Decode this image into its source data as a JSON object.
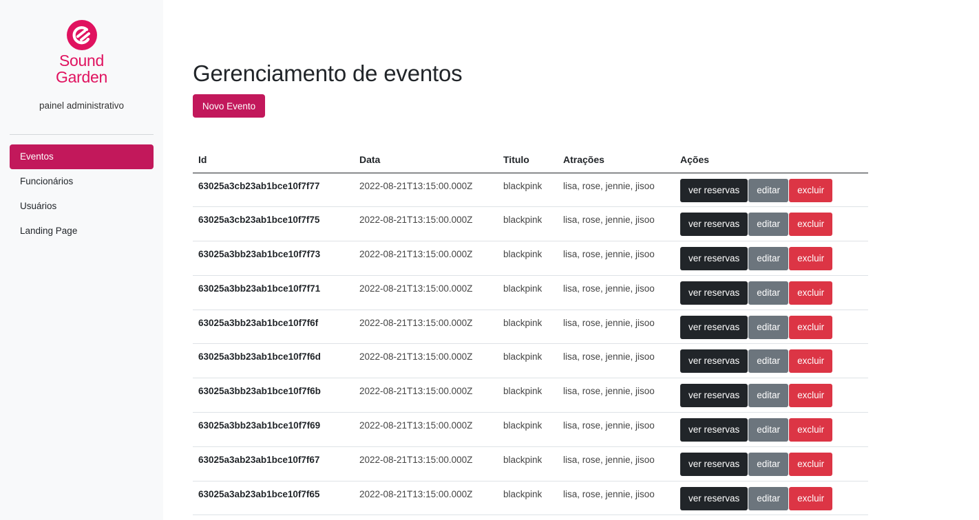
{
  "brand": {
    "line1": "Sound",
    "line2": "Garden",
    "tagline": "painel administrativo",
    "color": "#e0125f"
  },
  "nav": {
    "items": [
      {
        "label": "Eventos",
        "active": true
      },
      {
        "label": "Funcionários",
        "active": false
      },
      {
        "label": "Usuários",
        "active": false
      },
      {
        "label": "Landing Page",
        "active": false
      }
    ]
  },
  "main": {
    "title": "Gerenciamento de eventos",
    "new_button": "Novo Evento"
  },
  "table": {
    "headers": [
      "Id",
      "Data",
      "Titulo",
      "Atrações",
      "Ações"
    ],
    "actions": {
      "view": "ver reservas",
      "edit": "editar",
      "delete": "excluir"
    },
    "rows": [
      {
        "id": "63025a3cb23ab1bce10f7f77",
        "date": "2022-08-21T13:15:00.000Z",
        "title": "blackpink",
        "attractions": "lisa, rose, jennie, jisoo"
      },
      {
        "id": "63025a3cb23ab1bce10f7f75",
        "date": "2022-08-21T13:15:00.000Z",
        "title": "blackpink",
        "attractions": "lisa, rose, jennie, jisoo"
      },
      {
        "id": "63025a3bb23ab1bce10f7f73",
        "date": "2022-08-21T13:15:00.000Z",
        "title": "blackpink",
        "attractions": "lisa, rose, jennie, jisoo"
      },
      {
        "id": "63025a3bb23ab1bce10f7f71",
        "date": "2022-08-21T13:15:00.000Z",
        "title": "blackpink",
        "attractions": "lisa, rose, jennie, jisoo"
      },
      {
        "id": "63025a3bb23ab1bce10f7f6f",
        "date": "2022-08-21T13:15:00.000Z",
        "title": "blackpink",
        "attractions": "lisa, rose, jennie, jisoo"
      },
      {
        "id": "63025a3bb23ab1bce10f7f6d",
        "date": "2022-08-21T13:15:00.000Z",
        "title": "blackpink",
        "attractions": "lisa, rose, jennie, jisoo"
      },
      {
        "id": "63025a3bb23ab1bce10f7f6b",
        "date": "2022-08-21T13:15:00.000Z",
        "title": "blackpink",
        "attractions": "lisa, rose, jennie, jisoo"
      },
      {
        "id": "63025a3bb23ab1bce10f7f69",
        "date": "2022-08-21T13:15:00.000Z",
        "title": "blackpink",
        "attractions": "lisa, rose, jennie, jisoo"
      },
      {
        "id": "63025a3ab23ab1bce10f7f67",
        "date": "2022-08-21T13:15:00.000Z",
        "title": "blackpink",
        "attractions": "lisa, rose, jennie, jisoo"
      },
      {
        "id": "63025a3ab23ab1bce10f7f65",
        "date": "2022-08-21T13:15:00.000Z",
        "title": "blackpink",
        "attractions": "lisa, rose, jennie, jisoo"
      }
    ]
  },
  "colors": {
    "accent": "#c2185b",
    "dark": "#212529",
    "gray": "#6c757d",
    "danger": "#dc3545"
  }
}
